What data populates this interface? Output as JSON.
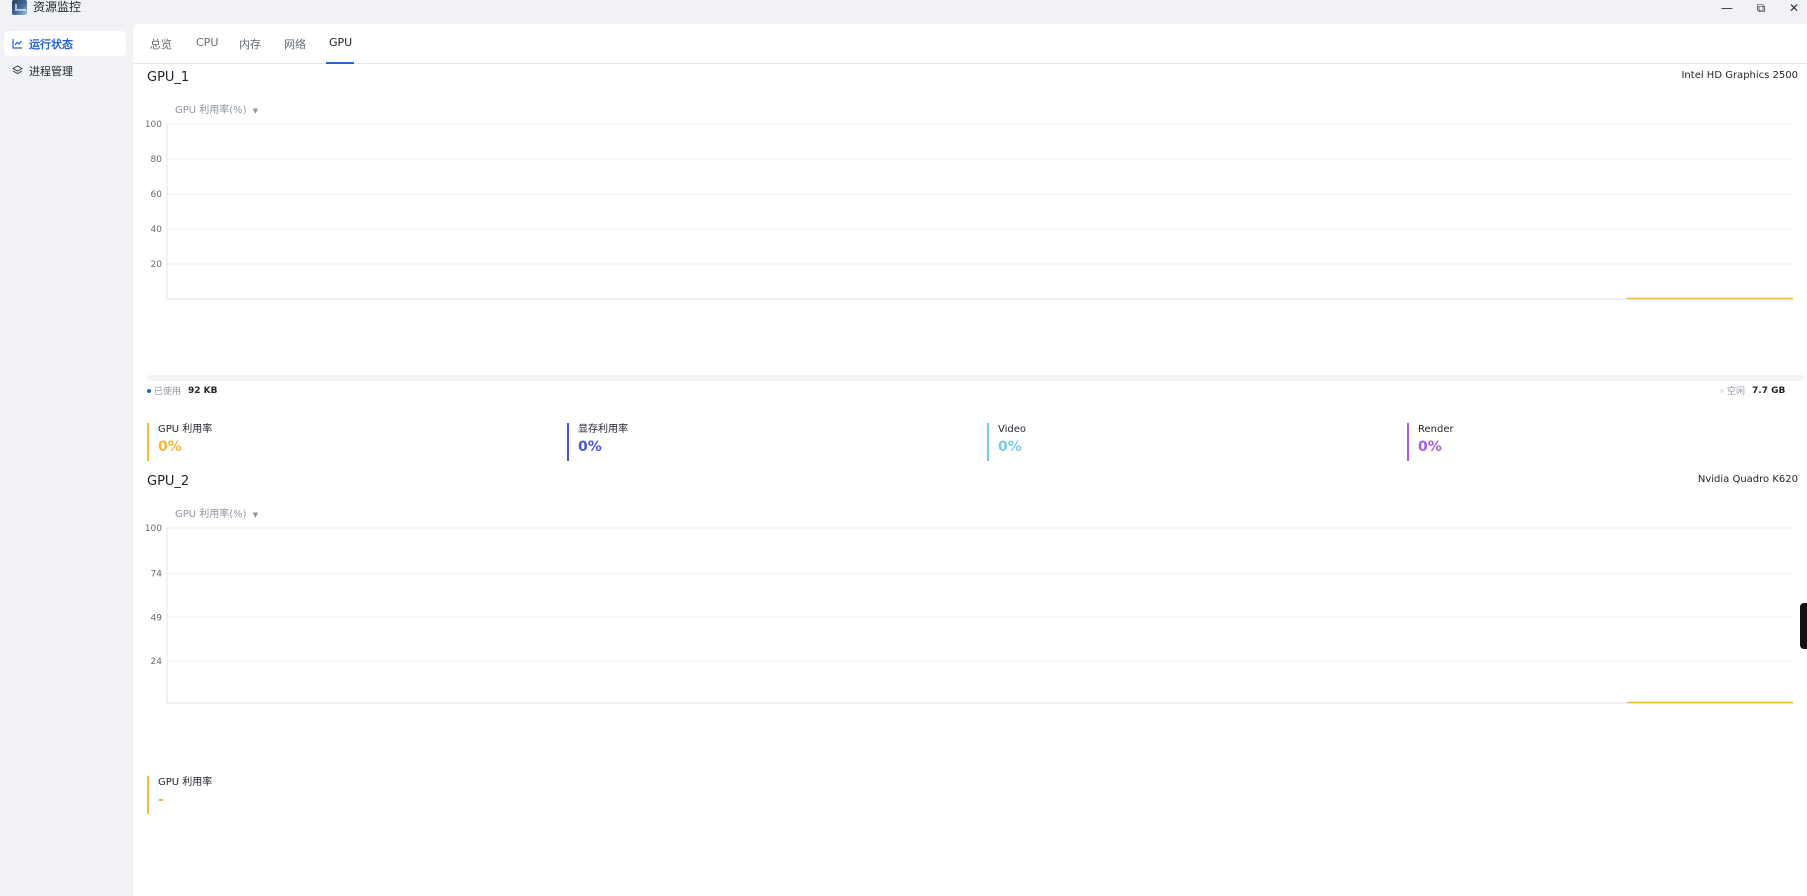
{
  "window": {
    "title": "资源监控",
    "controls": {
      "minimize": "—",
      "maximize": "⧉",
      "close": "✕"
    }
  },
  "sidebar": {
    "items": [
      {
        "label": "运行状态",
        "icon": "line-chart-icon",
        "active": true
      },
      {
        "label": "进程管理",
        "icon": "layers-icon",
        "active": false
      }
    ]
  },
  "tabs": [
    {
      "label": "总览"
    },
    {
      "label": "CPU"
    },
    {
      "label": "内存"
    },
    {
      "label": "网络"
    },
    {
      "label": "GPU",
      "active": true
    }
  ],
  "gpu1": {
    "title": "GPU_1",
    "model": "Intel HD Graphics 2500",
    "metric_select": "GPU 利用率(%)",
    "chart_data": {
      "type": "line",
      "series": [
        {
          "values": [
            0,
            0,
            0,
            0,
            0,
            0,
            0,
            0,
            0,
            0,
            0
          ]
        }
      ],
      "ylim": [
        0,
        100
      ],
      "yticks": [
        "100",
        "80",
        "60",
        "40",
        "20"
      ],
      "color": "#f5b63a"
    },
    "memory": {
      "used_label": "已使用",
      "used_value": "92 KB",
      "free_label": "空闲",
      "free_value": "7.7 GB",
      "used_fraction": 0.0
    },
    "stats": [
      {
        "label": "GPU 利用率",
        "value": "0%",
        "color": "#f5b63a"
      },
      {
        "label": "显存利用率",
        "value": "0%",
        "color": "#4a55d9"
      },
      {
        "label": "Video",
        "value": "0%",
        "color": "#7cc9e8"
      },
      {
        "label": "Render",
        "value": "0%",
        "color": "#a45de0"
      }
    ]
  },
  "gpu2": {
    "title": "GPU_2",
    "model": "Nvidia Quadro K620",
    "metric_select": "GPU 利用率(%)",
    "chart_data": {
      "type": "line",
      "series": [
        {
          "values": [
            0,
            0,
            0,
            0,
            0,
            0,
            0,
            0,
            0,
            0,
            0
          ]
        }
      ],
      "ylim": [
        0,
        100
      ],
      "yticks": [
        "100",
        "74",
        "49",
        "24"
      ],
      "color": "#f5b63a"
    },
    "stats": [
      {
        "label": "GPU 利用率",
        "value": "-",
        "color": "#f5b63a"
      }
    ]
  }
}
